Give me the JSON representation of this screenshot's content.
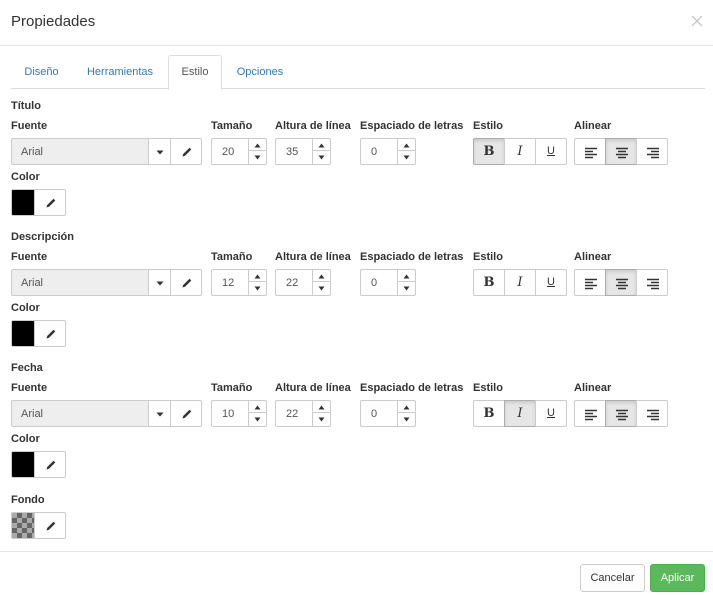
{
  "modal": {
    "title": "Propiedades",
    "close_icon": "close-icon"
  },
  "tabs": [
    {
      "label": "Diseño",
      "active": false
    },
    {
      "label": "Herramientas",
      "active": false
    },
    {
      "label": "Estilo",
      "active": true
    },
    {
      "label": "Opciones",
      "active": false
    }
  ],
  "labels": {
    "fuente": "Fuente",
    "tamano": "Tamaño",
    "altura": "Altura de línea",
    "espaciado": "Espaciado de letras",
    "estilo": "Estilo",
    "alinear": "Alinear",
    "color": "Color",
    "fondo": "Fondo"
  },
  "style_glyphs": {
    "bold": "B",
    "italic": "I",
    "underline": "U"
  },
  "sections": [
    {
      "title": "Título",
      "font": "Arial",
      "size": "20",
      "line_height": "35",
      "letter_spacing": "0",
      "bold": true,
      "italic": false,
      "underline": false,
      "align": "center",
      "color": "#000000"
    },
    {
      "title": "Descripción",
      "font": "Arial",
      "size": "12",
      "line_height": "22",
      "letter_spacing": "0",
      "bold": false,
      "italic": false,
      "underline": false,
      "align": "center",
      "color": "#000000"
    },
    {
      "title": "Fecha",
      "font": "Arial",
      "size": "10",
      "line_height": "22",
      "letter_spacing": "0",
      "bold": false,
      "italic": true,
      "underline": false,
      "align": "center",
      "color": "#000000"
    }
  ],
  "background": {
    "pattern": "transparent-checker"
  },
  "footer": {
    "cancel_label": "Cancelar",
    "apply_label": "Aplicar"
  },
  "colors": {
    "accent": "#337ab7",
    "apply": "#5cb85c",
    "active_segment": "#e6e6e6"
  }
}
